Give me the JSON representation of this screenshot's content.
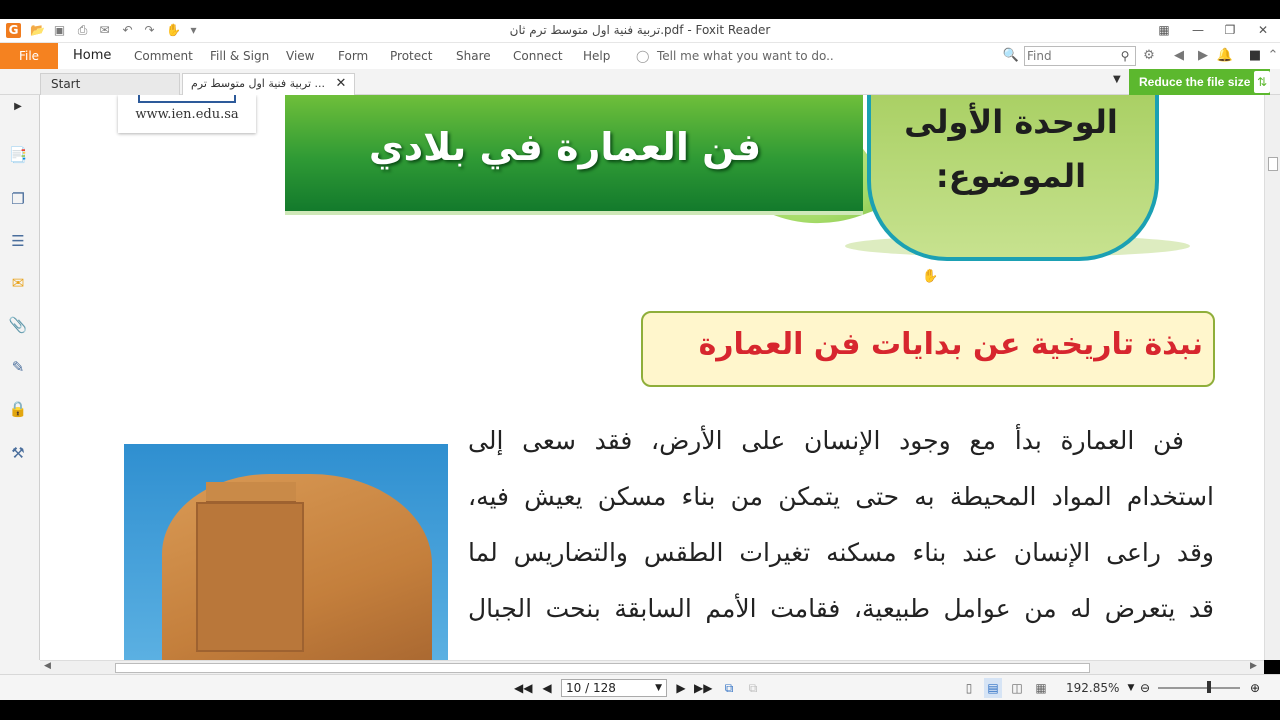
{
  "window": {
    "title": "تربية فنية اول متوسط ترم ثان.pdf - Foxit Reader",
    "app_icon": "G"
  },
  "menu": {
    "file": "File",
    "items": [
      "Home",
      "Comment",
      "Fill & Sign",
      "View",
      "Form",
      "Protect",
      "Share",
      "Connect",
      "Help"
    ],
    "tell_me": "Tell me what you want to do..",
    "find_placeholder": "Find"
  },
  "tabs": {
    "start": "Start",
    "document": "تربية فنية اول متوسط ترم ... ",
    "reduce": "Reduce the file size"
  },
  "page": {
    "url": "www.ien.edu.sa",
    "banner_title": "فن العمارة في بلادي",
    "unit_line1": "الوحدة الأولى",
    "unit_line2": "الموضوع:",
    "heading": "نبذة تاريخية عن بدايات فن العمارة",
    "paragraph_lines": [
      "فن العمارة بدأ مع وجود الإنسان على الأرض، فقد سعى إلى",
      "استخدام المواد المحيطة به حتى يتمكن من بناء مسكن يعيش فيه،",
      "وقد راعى الإنسان عند بناء مسكنه تغيرات الطقس والتضاريس لما",
      "قد يتعرض له من عوامل طبيعية، فقامت الأمم السابقة بنحت الجبال"
    ]
  },
  "status": {
    "page_indicator": "10 / 128",
    "zoom": "192.85%"
  },
  "colors": {
    "file_tab": "#f58220",
    "reduce_button": "#5cb82e",
    "heading_red": "#d7262e",
    "banner_green": "#2f9a35"
  }
}
